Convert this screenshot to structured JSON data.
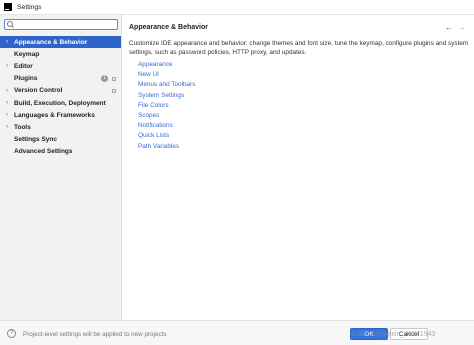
{
  "window": {
    "title": "Settings"
  },
  "sidebar": {
    "search": {
      "value": "",
      "placeholder": ""
    },
    "items": [
      {
        "label": "Appearance & Behavior",
        "chevron": "›",
        "selected": true
      },
      {
        "label": "Keymap",
        "chevron": ""
      },
      {
        "label": "Editor",
        "chevron": "›"
      },
      {
        "label": "Plugins",
        "chevron": "",
        "badge": "1"
      },
      {
        "label": "Version Control",
        "chevron": "›"
      },
      {
        "label": "Build, Execution, Deployment",
        "chevron": "›"
      },
      {
        "label": "Languages & Frameworks",
        "chevron": "›"
      },
      {
        "label": "Tools",
        "chevron": "›"
      },
      {
        "label": "Settings Sync",
        "chevron": ""
      },
      {
        "label": "Advanced Settings",
        "chevron": ""
      }
    ]
  },
  "main": {
    "title": "Appearance & Behavior",
    "nav": {
      "back": "←",
      "forward": "→"
    },
    "description": "Customize IDE appearance and behavior: change themes and font size, tune the keymap, configure plugins and system settings, such as password policies, HTTP proxy, and updates.",
    "links": [
      "Appearance",
      "New UI",
      "Menus and Toolbars",
      "System Settings",
      "File Colors",
      "Scopes",
      "Notifications",
      "Quick Lists",
      "Path Variables"
    ]
  },
  "footer": {
    "help": "?",
    "note": "Project-level settings will be applied to new projects",
    "ok": "OK",
    "cancel": "Cancel"
  },
  "watermark": "CSDN @weixin_46741943",
  "colors": {
    "accent": "#2f65ca",
    "link": "#3a6bd2",
    "ok_button": "#3574e0"
  }
}
